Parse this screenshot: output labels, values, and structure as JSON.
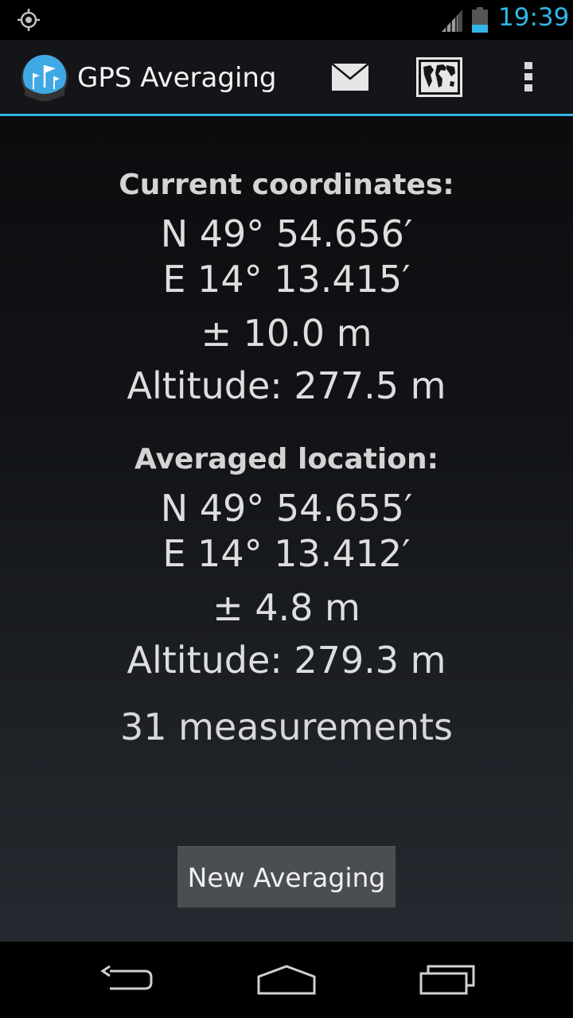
{
  "status_bar": {
    "time": "19:39",
    "icons": [
      "gps-icon",
      "signal-icon",
      "battery-icon"
    ],
    "accent_color": "#33b5e5"
  },
  "action_bar": {
    "title": "GPS Averaging",
    "icons": [
      "app-icon",
      "mail-icon",
      "map-icon",
      "overflow-menu-icon"
    ]
  },
  "current": {
    "heading": "Current coordinates:",
    "lat": "N 49° 54.656′",
    "lon": "E 14° 13.415′",
    "accuracy": "± 10.0 m",
    "altitude": "Altitude: 277.5 m"
  },
  "averaged": {
    "heading": "Averaged location:",
    "lat": "N 49° 54.655′",
    "lon": "E 14° 13.412′",
    "accuracy": "± 4.8 m",
    "altitude": "Altitude: 279.3 m"
  },
  "measurements": "31 measurements",
  "new_button_label": "New Averaging",
  "nav_bar": {
    "icons": [
      "back-icon",
      "home-icon",
      "recent-apps-icon"
    ]
  }
}
